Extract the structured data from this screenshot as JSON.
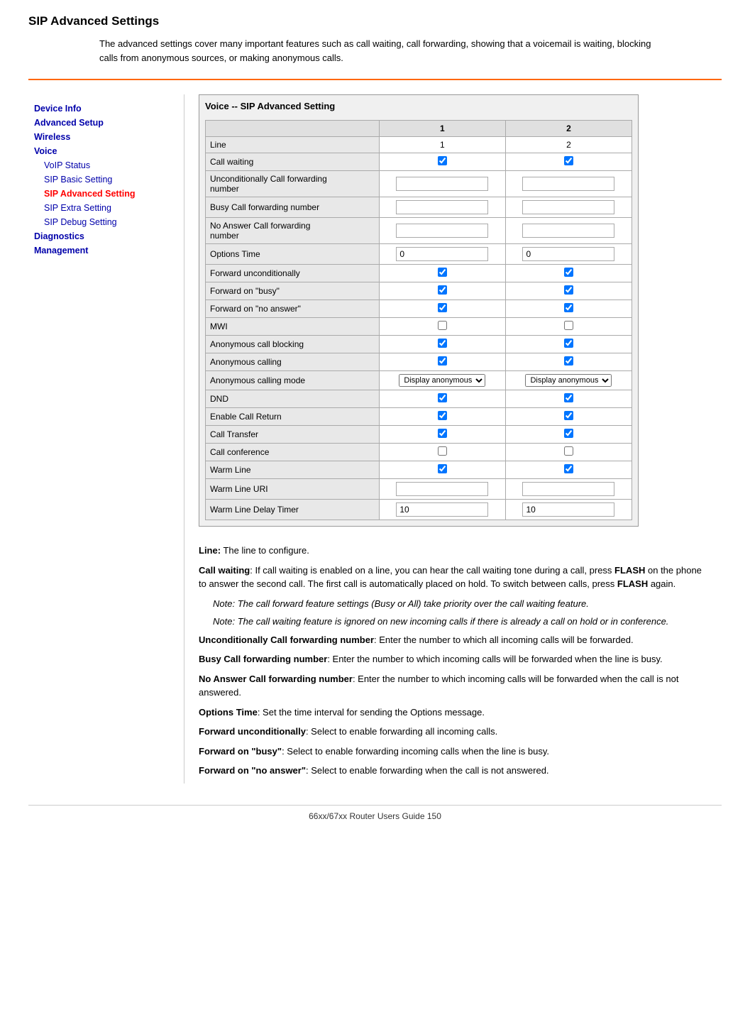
{
  "page": {
    "title": "SIP Advanced Settings",
    "footer": "66xx/67xx Router Users Guide     150"
  },
  "intro": {
    "text": "The advanced settings cover many important features such as call waiting, call forwarding, showing that a voicemail is waiting, blocking calls from anonymous sources, or making anonymous calls."
  },
  "sidebar": {
    "items": [
      {
        "id": "device-info",
        "label": "Device Info",
        "level": "level1",
        "active": false
      },
      {
        "id": "advanced-setup",
        "label": "Advanced Setup",
        "level": "level1",
        "active": false
      },
      {
        "id": "wireless",
        "label": "Wireless",
        "level": "level1",
        "active": false
      },
      {
        "id": "voice",
        "label": "Voice",
        "level": "level1",
        "active": false
      },
      {
        "id": "voip-status",
        "label": "VoIP Status",
        "level": "level2",
        "active": false
      },
      {
        "id": "sip-basic-setting",
        "label": "SIP Basic Setting",
        "level": "level2",
        "active": false
      },
      {
        "id": "sip-advanced-setting",
        "label": "SIP Advanced Setting",
        "level": "level2",
        "active": true
      },
      {
        "id": "sip-extra-setting",
        "label": "SIP Extra Setting",
        "level": "level2",
        "active": false
      },
      {
        "id": "sip-debug-setting",
        "label": "SIP Debug Setting",
        "level": "level2",
        "active": false
      },
      {
        "id": "diagnostics",
        "label": "Diagnostics",
        "level": "level1",
        "active": false
      },
      {
        "id": "management",
        "label": "Management",
        "level": "level1",
        "active": false
      }
    ]
  },
  "settings": {
    "panel_title": "Voice -- SIP Advanced Setting",
    "col_header_feature": "",
    "col_header_line1": "1",
    "col_header_line2": "2",
    "rows": [
      {
        "id": "line",
        "label": "Line",
        "type": "header_row",
        "val1": "1",
        "val2": "2"
      },
      {
        "id": "call-waiting",
        "label": "Call waiting",
        "type": "checkbox",
        "checked1": true,
        "checked2": true
      },
      {
        "id": "unconditional-forward",
        "label": "Unconditionally Call forwarding\nnumber",
        "type": "text",
        "val1": "",
        "val2": ""
      },
      {
        "id": "busy-forward",
        "label": "Busy Call forwarding number",
        "type": "text",
        "val1": "",
        "val2": ""
      },
      {
        "id": "no-answer-forward",
        "label": "No Answer Call forwarding\nnumber",
        "type": "text",
        "val1": "",
        "val2": ""
      },
      {
        "id": "options-time",
        "label": "Options Time",
        "type": "text",
        "val1": "0",
        "val2": "0"
      },
      {
        "id": "forward-unconditionally",
        "label": "Forward unconditionally",
        "type": "checkbox",
        "checked1": true,
        "checked2": true
      },
      {
        "id": "forward-busy",
        "label": "Forward on \"busy\"",
        "type": "checkbox",
        "checked1": true,
        "checked2": true
      },
      {
        "id": "forward-no-answer",
        "label": "Forward on \"no answer\"",
        "type": "checkbox",
        "checked1": true,
        "checked2": true
      },
      {
        "id": "mwi",
        "label": "MWI",
        "type": "checkbox",
        "checked1": false,
        "checked2": false
      },
      {
        "id": "anon-call-blocking",
        "label": "Anonymous call blocking",
        "type": "checkbox",
        "checked1": true,
        "checked2": true
      },
      {
        "id": "anon-calling",
        "label": "Anonymous calling",
        "type": "checkbox",
        "checked1": true,
        "checked2": true
      },
      {
        "id": "anon-calling-mode",
        "label": "Anonymous calling mode",
        "type": "select",
        "val1": "Display anonymous",
        "val2": "Display anonymous"
      },
      {
        "id": "dnd",
        "label": "DND",
        "type": "checkbox",
        "checked1": true,
        "checked2": true
      },
      {
        "id": "enable-call-return",
        "label": "Enable Call Return",
        "type": "checkbox",
        "checked1": true,
        "checked2": true
      },
      {
        "id": "call-transfer",
        "label": "Call Transfer",
        "type": "checkbox",
        "checked1": true,
        "checked2": true
      },
      {
        "id": "call-conference",
        "label": "Call conference",
        "type": "checkbox",
        "checked1": false,
        "checked2": false
      },
      {
        "id": "warm-line",
        "label": "Warm Line",
        "type": "checkbox",
        "checked1": true,
        "checked2": true
      },
      {
        "id": "warm-line-uri",
        "label": "Warm Line URI",
        "type": "text",
        "val1": "",
        "val2": ""
      },
      {
        "id": "warm-line-delay",
        "label": "Warm Line Delay Timer",
        "type": "text",
        "val1": "10",
        "val2": "10"
      }
    ]
  },
  "descriptions": [
    {
      "id": "desc-line",
      "term": "Line:",
      "text": " The line to configure."
    },
    {
      "id": "desc-call-waiting",
      "term": "Call waiting",
      "text": ":  If call waiting is enabled on a line, you can hear the call waiting tone during a call, press FLASH on the phone to answer the second call. The first call is automatically placed on hold. To switch between calls, press FLASH again.",
      "bold_inline": [
        "FLASH",
        "FLASH"
      ]
    },
    {
      "id": "note1",
      "type": "note",
      "term": "Note:",
      "text": " The call forward feature settings (Busy or All) take priority over the call waiting feature."
    },
    {
      "id": "note2",
      "type": "note",
      "term": "Note:",
      "text": " The call waiting feature is ignored on new incoming calls if there is already a call on hold or in conference."
    },
    {
      "id": "desc-uncond-forward",
      "term": "Unconditionally Call forwarding number",
      "text": ": Enter the number to which all incoming calls will be forwarded."
    },
    {
      "id": "desc-busy-forward",
      "term": "Busy Call forwarding number",
      "text": ": Enter the number to which incoming calls will be forwarded when the line is busy."
    },
    {
      "id": "desc-noanswer-forward",
      "term": "No Answer Call forwarding number",
      "text": ": Enter the number to which incoming calls will be forwarded when the call is not answered."
    },
    {
      "id": "desc-options-time",
      "term": "Options Time",
      "text": ": Set the time interval for sending the Options message."
    },
    {
      "id": "desc-forward-uncond",
      "term": "Forward unconditionally",
      "text": ": Select to enable forwarding all incoming calls."
    },
    {
      "id": "desc-forward-busy",
      "term": "Forward on \"busy\"",
      "text": ": Select to enable forwarding incoming calls when the line is busy."
    },
    {
      "id": "desc-forward-noanswer",
      "term": "Forward on \"no answer\"",
      "text": ": Select to enable forwarding when the call is not answered."
    }
  ],
  "colors": {
    "link": "#0000cc",
    "active_link": "#cc0000",
    "orange_divider": "#ff6600"
  }
}
